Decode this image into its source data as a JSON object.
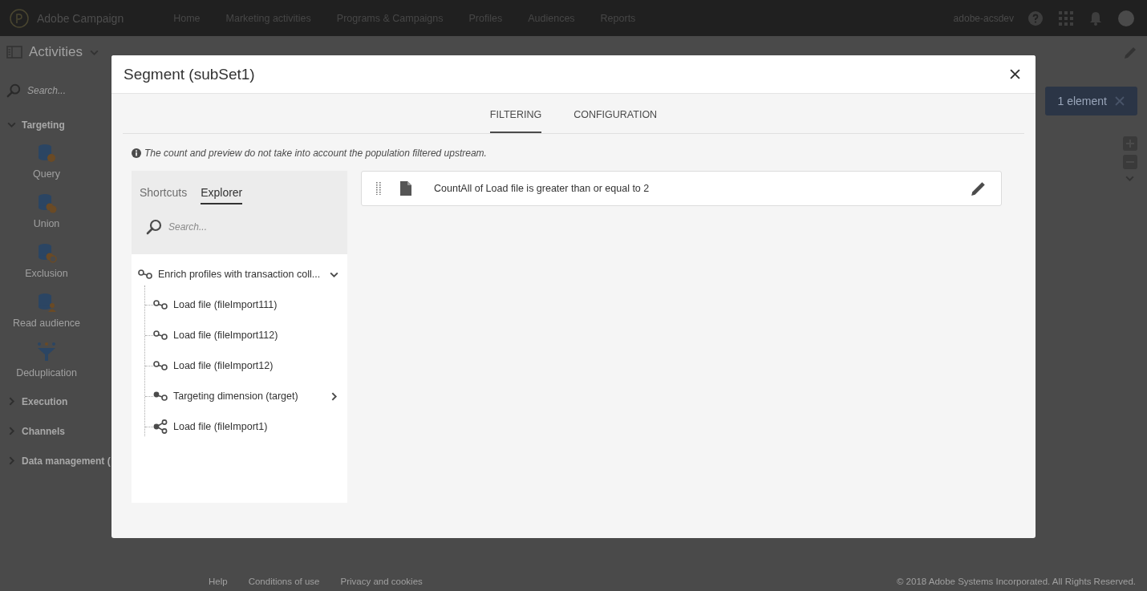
{
  "top_bar": {
    "logo": "Adobe Campaign",
    "nav": [
      {
        "label": "Home"
      },
      {
        "label": "Marketing activities"
      },
      {
        "label": "Programs & Campaigns"
      },
      {
        "label": "Profiles"
      },
      {
        "label": "Audiences"
      },
      {
        "label": "Reports"
      }
    ],
    "user": "adobe-acsdev"
  },
  "sidebar": {
    "title": "Activities",
    "search": {
      "placeholder": "Search..."
    },
    "groups": [
      {
        "label": "Targeting",
        "expanded": true,
        "items": [
          {
            "label": "Query",
            "kind": "query"
          },
          {
            "label": "Union",
            "kind": "union"
          },
          {
            "label": "Exclusion",
            "kind": "exclusion"
          },
          {
            "label": "Read audience",
            "kind": "audience"
          },
          {
            "label": "Deduplication",
            "kind": "dedup"
          }
        ]
      },
      {
        "label": "Execution",
        "expanded": false
      },
      {
        "label": "Channels",
        "expanded": false
      },
      {
        "label": "Data management (",
        "expanded": false
      }
    ]
  },
  "canvas_toolbar": {
    "selection_button": "1 element"
  },
  "footer": {
    "links": [
      "Help",
      "Conditions of use",
      "Privacy and cookies"
    ],
    "copyright": "© 2018 Adobe Systems Incorporated. All Rights Reserved."
  },
  "dialog": {
    "title": "Segment (subSet1)",
    "tabs": [
      {
        "label": "FILTERING",
        "selected": true
      },
      {
        "label": "CONFIGURATION",
        "selected": false
      }
    ],
    "info": "The count and preview do not take into account the population filtered upstream.",
    "explorer": {
      "tabs": [
        {
          "label": "Shortcuts",
          "selected": false
        },
        {
          "label": "Explorer",
          "selected": true
        }
      ],
      "search": {
        "placeholder": "Search..."
      },
      "tree": [
        {
          "label": "Enrich profiles with transaction coll...",
          "kind": "link",
          "expanded": true,
          "children": [
            {
              "label": "Load file (fileImport111)",
              "kind": "link"
            },
            {
              "label": "Load file (fileImport112)",
              "kind": "link"
            },
            {
              "label": "Load file (fileImport12)",
              "kind": "link"
            },
            {
              "label": "Targeting dimension (target)",
              "kind": "dimension",
              "expanded": false
            },
            {
              "label": "Load file (fileImport1)",
              "kind": "share"
            }
          ]
        }
      ]
    },
    "conditions": [
      {
        "text": "CountAll of Load file is greater than or equal to 2"
      }
    ]
  }
}
